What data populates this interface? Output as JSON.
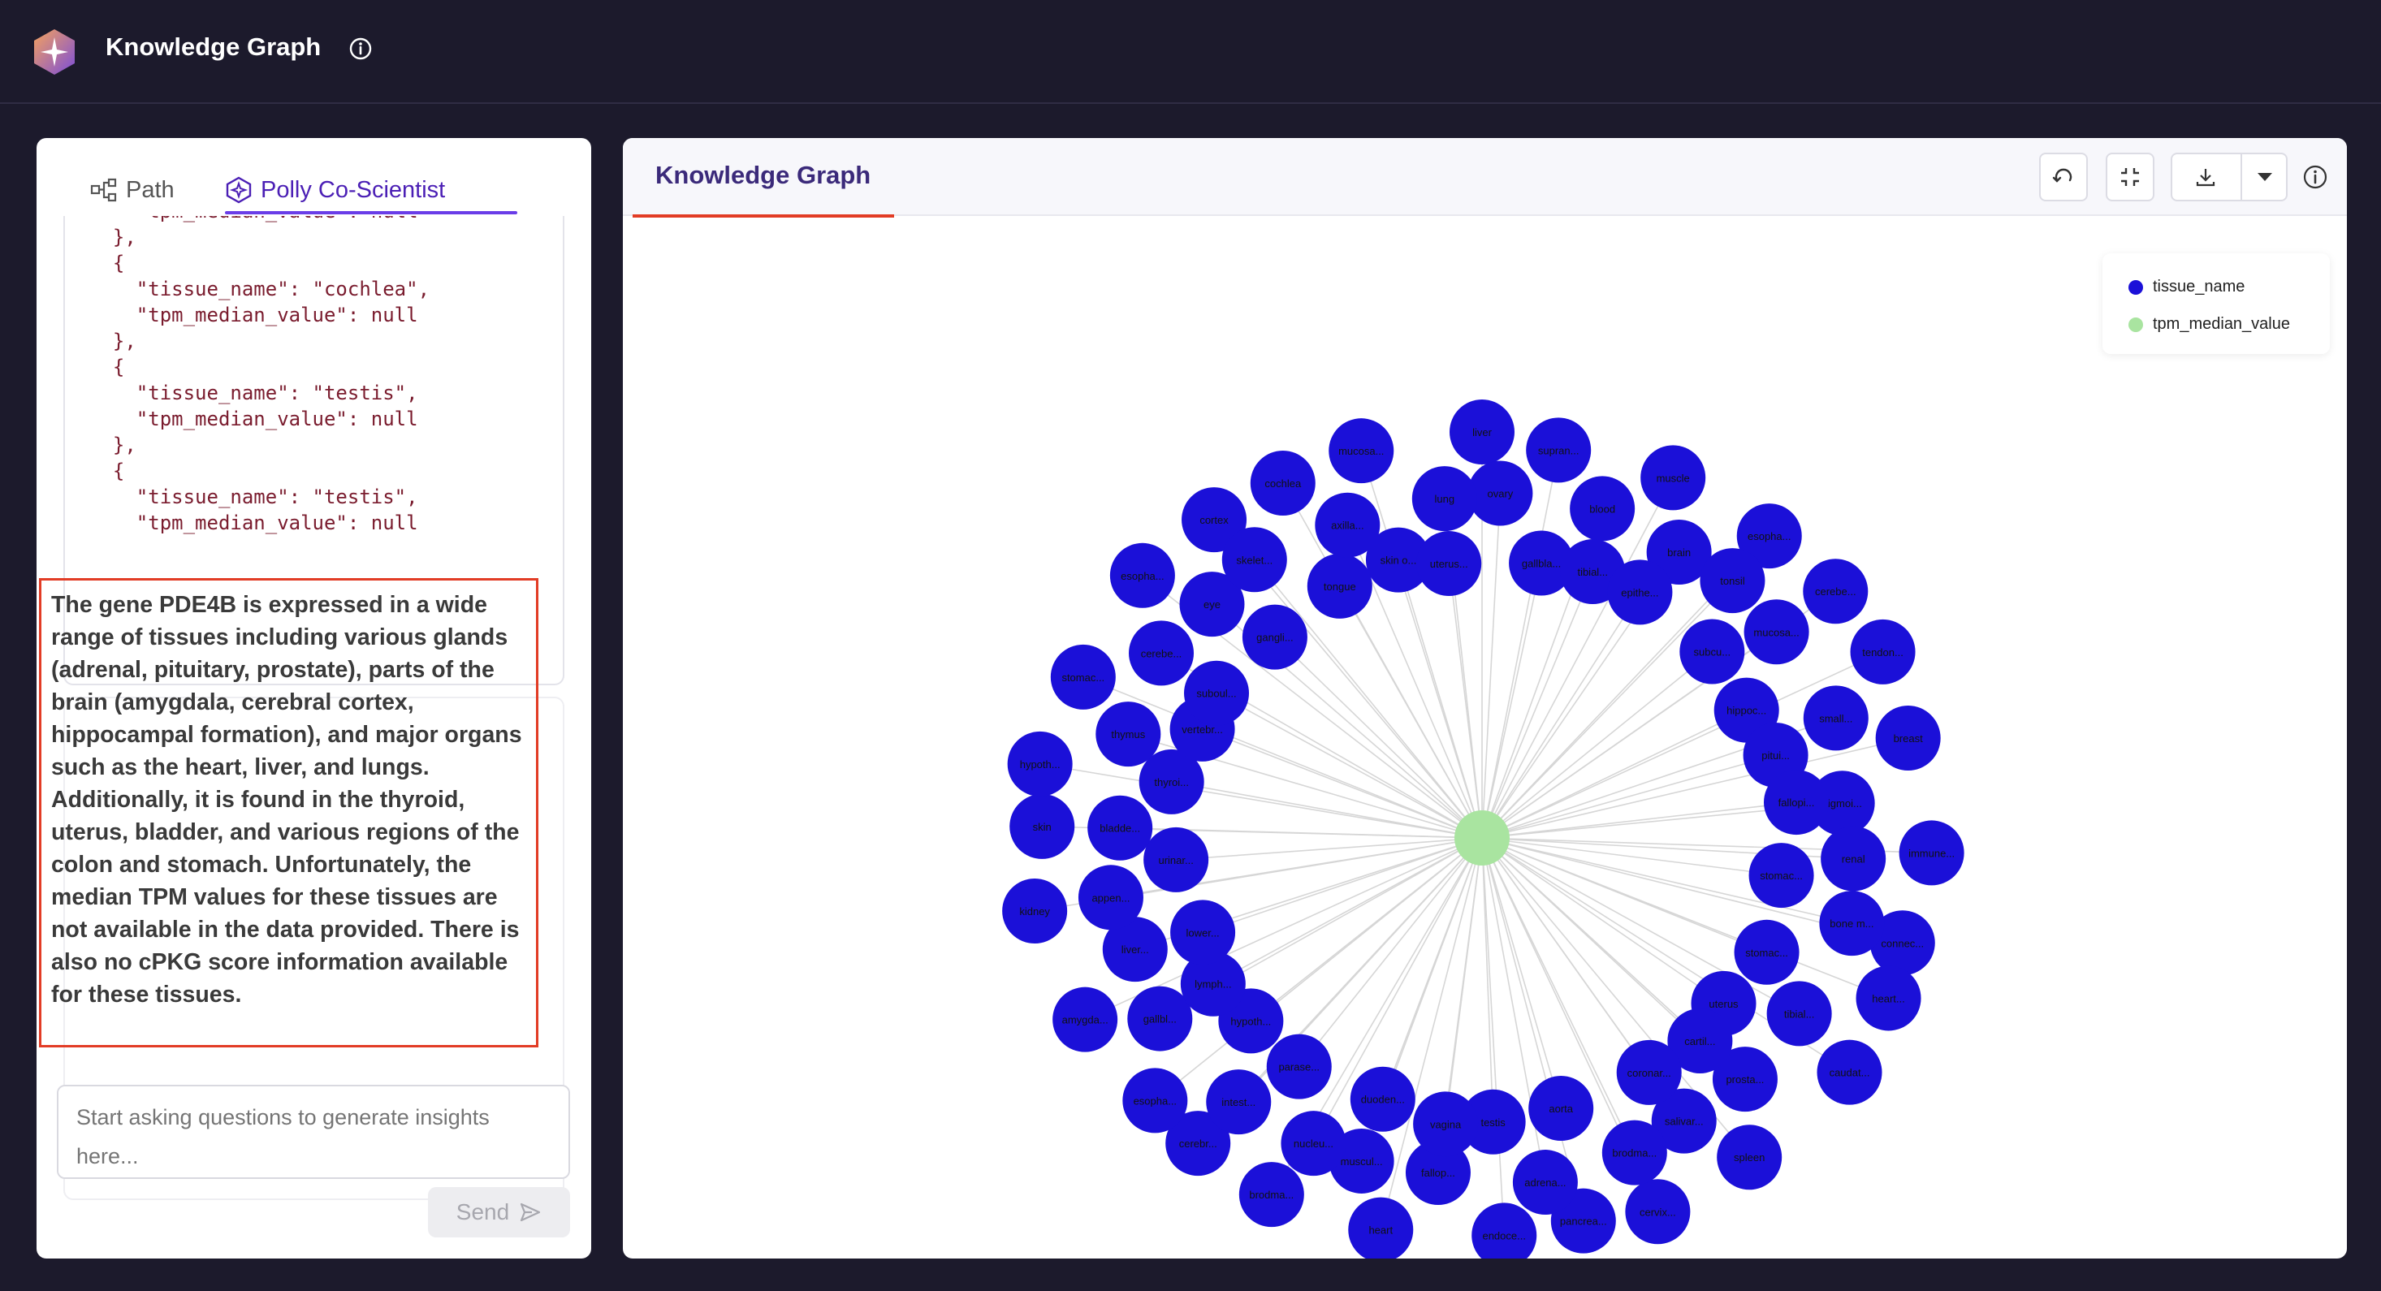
{
  "app": {
    "title": "Knowledge Graph"
  },
  "left": {
    "tabs": [
      {
        "label": "Path",
        "icon": "path-icon"
      },
      {
        "label": "Polly Co-Scientist",
        "icon": "polly-icon"
      }
    ],
    "code_snippet": "    \"tpm_median_value\": null\n  },\n  {\n    \"tissue_name\": \"cochlea\",\n    \"tpm_median_value\": null\n  },\n  {\n    \"tissue_name\": \"testis\",\n    \"tpm_median_value\": null\n  },\n  {\n    \"tissue_name\": \"testis\",\n    \"tpm_median_value\": null",
    "answer": "The gene PDE4B is expressed in a wide range of tissues including various glands (adrenal, pituitary, prostate), parts of the brain (amygdala, cerebral cortex, hippocampal formation), and major organs such as the heart, liver, and lungs. Additionally, it is found in the thyroid, uterus, bladder, and various regions of the colon and stomach. Unfortunately, the median TPM values for these tissues are not available in the data provided. There is also no cPKG score information available for these tissues.",
    "input_placeholder": "Start asking questions to generate insights here...",
    "send_label": "Send"
  },
  "right": {
    "title": "Knowledge Graph",
    "tools": [
      "refresh-icon",
      "fullscreen-icon",
      "download-icon",
      "chevron-down-icon",
      "info-icon"
    ],
    "legend": [
      {
        "label": "tissue_name",
        "color": "#1b10d8"
      },
      {
        "label": "tpm_median_value",
        "color": "#a9e4a0"
      }
    ],
    "graph": {
      "nodes": [
        {
          "label": "liver"
        },
        {
          "label": "ovary"
        },
        {
          "label": "gallbla..."
        },
        {
          "label": "supran..."
        },
        {
          "label": "blood"
        },
        {
          "label": "tibial..."
        },
        {
          "label": "muscle"
        },
        {
          "label": "brain"
        },
        {
          "label": "epithe..."
        },
        {
          "label": "esopha..."
        },
        {
          "label": "tonsil"
        },
        {
          "label": "subcu..."
        },
        {
          "label": "cerebe..."
        },
        {
          "label": "mucosa..."
        },
        {
          "label": "hippoc..."
        },
        {
          "label": "tendon..."
        },
        {
          "label": "small..."
        },
        {
          "label": "pitui..."
        },
        {
          "label": "breast"
        },
        {
          "label": "sigmoi..."
        },
        {
          "label": "fallopi..."
        },
        {
          "label": "immune..."
        },
        {
          "label": "renal"
        },
        {
          "label": "stomac..."
        },
        {
          "label": "connec..."
        },
        {
          "label": "bone m..."
        },
        {
          "label": "stomac..."
        },
        {
          "label": "heart..."
        },
        {
          "label": "tibial..."
        },
        {
          "label": "uterus"
        },
        {
          "label": "caudat..."
        },
        {
          "label": "prosta..."
        },
        {
          "label": "cartil..."
        },
        {
          "label": "spleen"
        },
        {
          "label": "salivar..."
        },
        {
          "label": "coronar..."
        },
        {
          "label": "cervix..."
        },
        {
          "label": "brodma..."
        },
        {
          "label": "aorta"
        },
        {
          "label": "pancrea..."
        },
        {
          "label": "adrena..."
        },
        {
          "label": "testis"
        },
        {
          "label": "endoce..."
        },
        {
          "label": "fallop..."
        },
        {
          "label": "vagina"
        },
        {
          "label": "heart"
        },
        {
          "label": "muscul..."
        },
        {
          "label": "duoden..."
        },
        {
          "label": "brodma..."
        },
        {
          "label": "nucleu..."
        },
        {
          "label": "parase..."
        },
        {
          "label": "cerebr..."
        },
        {
          "label": "intest..."
        },
        {
          "label": "hypoth..."
        },
        {
          "label": "esopha..."
        },
        {
          "label": "gallbl..."
        },
        {
          "label": "lymph..."
        },
        {
          "label": "amygda..."
        },
        {
          "label": "liver..."
        },
        {
          "label": "lower..."
        },
        {
          "label": "kidney"
        },
        {
          "label": "appen..."
        },
        {
          "label": "urinar..."
        },
        {
          "label": "skin"
        },
        {
          "label": "bladde..."
        },
        {
          "label": "thyroi..."
        },
        {
          "label": "hypoth..."
        },
        {
          "label": "thymus"
        },
        {
          "label": "vertebr..."
        },
        {
          "label": "stomac..."
        },
        {
          "label": "cerebe..."
        },
        {
          "label": "suboul..."
        },
        {
          "label": "esopha..."
        },
        {
          "label": "eye"
        },
        {
          "label": "gangli..."
        },
        {
          "label": "cortex"
        },
        {
          "label": "skelet..."
        },
        {
          "label": "tongue"
        },
        {
          "label": "cochlea"
        },
        {
          "label": "axilla..."
        },
        {
          "label": "skin o..."
        },
        {
          "label": "mucosa..."
        },
        {
          "label": "lung"
        },
        {
          "label": "uterus..."
        }
      ]
    }
  }
}
